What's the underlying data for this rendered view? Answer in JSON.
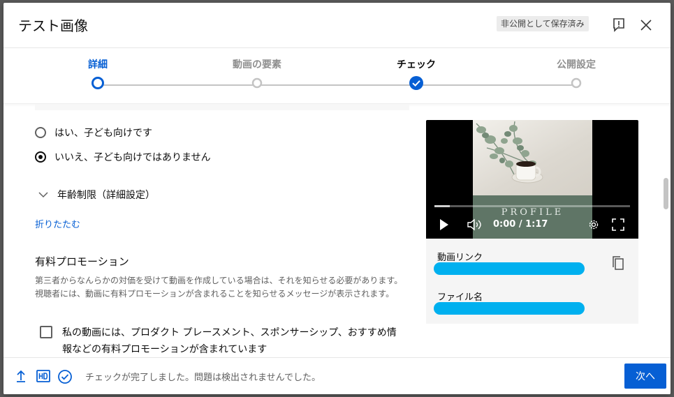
{
  "header": {
    "title": "テスト画像",
    "save_status": "非公開として保存済み"
  },
  "stepper": {
    "steps": [
      {
        "label": "詳細",
        "state": "active"
      },
      {
        "label": "動画の要素",
        "state": "pending"
      },
      {
        "label": "チェック",
        "state": "done"
      },
      {
        "label": "公開設定",
        "state": "pending"
      }
    ]
  },
  "audience": {
    "option_yes": "はい、子ども向けです",
    "option_no": "いいえ、子ども向けではありません",
    "selected": "no"
  },
  "age_restriction": {
    "label": "年齢制限（詳細設定）"
  },
  "collapse_link": "折りたたむ",
  "promotion": {
    "title": "有料プロモーション",
    "description": "第三者からなんらかの対価を受けて動画を作成している場合は、それを知らせる必要があります。視聴者には、動画に有料プロモーションが含まれることを知らせるメッセージが表示されます。",
    "checkbox_label": "私の動画には、プロダクト プレースメント、スポンサーシップ、おすすめ情報などの有料プロモーションが含まれています",
    "checked": false
  },
  "video": {
    "thumbnail_text": "PROFILE",
    "time": "0:00 / 1:17",
    "progress": 0.08,
    "link_label": "動画リンク",
    "filename_label": "ファイル名"
  },
  "footer": {
    "status": "チェックが完了しました。問題は検出されませんでした。",
    "next_label": "次へ"
  },
  "colors": {
    "accent": "#065fd4",
    "redaction": "#00b0ef"
  }
}
